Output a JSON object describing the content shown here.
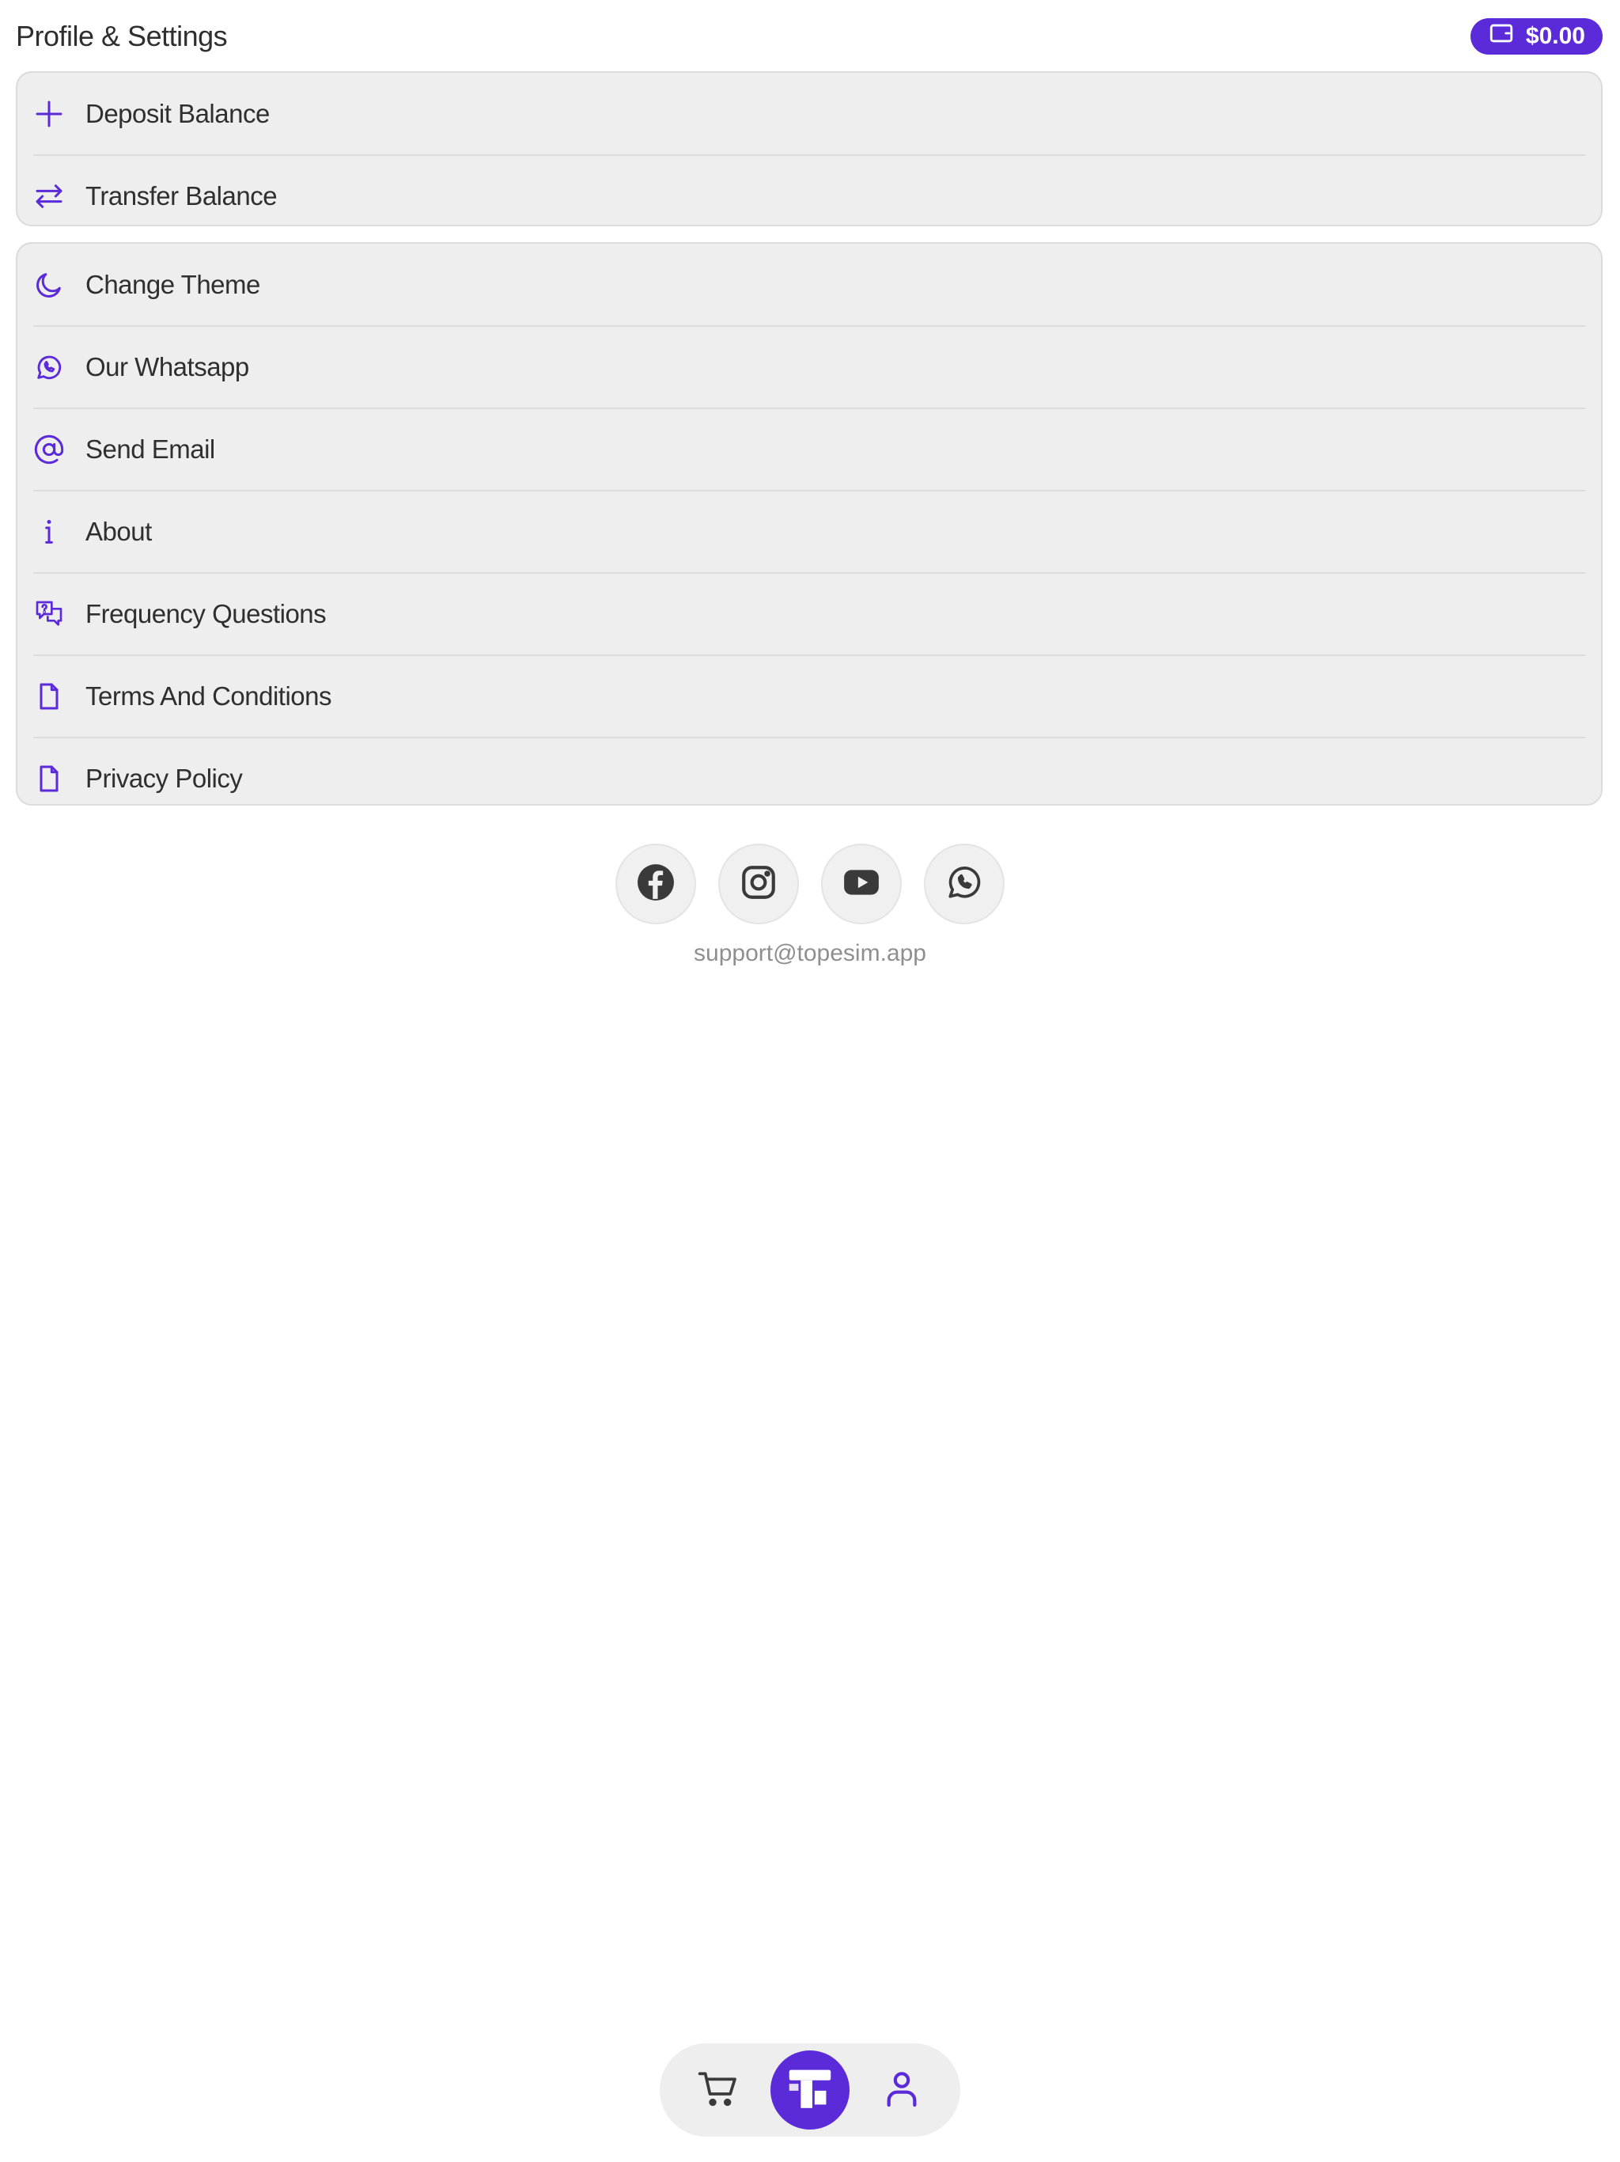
{
  "header": {
    "title": "Profile & Settings",
    "balance": "$0.00",
    "balance_icon": "wallet-icon"
  },
  "colors": {
    "accent": "#5b2bd9",
    "card_bg": "#eeeeee",
    "text": "#2f2f2f"
  },
  "balance_menu": {
    "items": [
      {
        "label": "Deposit Balance",
        "icon": "plus-icon"
      },
      {
        "label": "Transfer Balance",
        "icon": "transfer-arrows-icon"
      }
    ]
  },
  "settings_menu": {
    "items": [
      {
        "label": "Change Theme",
        "icon": "moon-icon"
      },
      {
        "label": "Our Whatsapp",
        "icon": "whatsapp-icon"
      },
      {
        "label": "Send Email",
        "icon": "at-sign-icon"
      },
      {
        "label": "About",
        "icon": "info-icon"
      },
      {
        "label": "Frequency Questions",
        "icon": "question-chat-icon"
      },
      {
        "label": "Terms And Conditions",
        "icon": "document-icon"
      },
      {
        "label": "Privacy Policy",
        "icon": "document-icon"
      }
    ]
  },
  "socials": [
    "facebook-icon",
    "instagram-icon",
    "youtube-icon",
    "whatsapp-icon"
  ],
  "support_email": "support@topesim.app",
  "bottom_nav": {
    "items": [
      "cart-icon",
      "home-logo-icon",
      "profile-icon"
    ],
    "active": "profile-icon"
  }
}
